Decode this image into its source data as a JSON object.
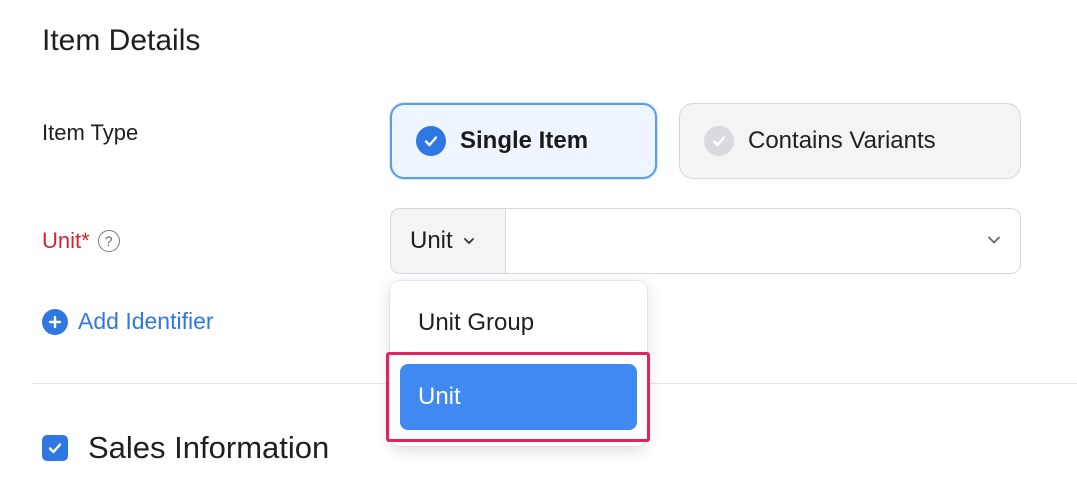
{
  "section": {
    "title": "Item Details"
  },
  "item_type": {
    "label": "Item Type",
    "options": [
      {
        "label": "Single Item",
        "selected": true
      },
      {
        "label": "Contains Variants",
        "selected": false
      }
    ]
  },
  "unit": {
    "label": "Unit*",
    "help_icon": "question-circle-icon",
    "toggle_label": "Unit",
    "value": "",
    "dropdown": {
      "options": [
        "Unit Group",
        "Unit"
      ],
      "highlighted": "Unit"
    }
  },
  "add_identifier": {
    "label": "Add Identifier"
  },
  "sales": {
    "label": "Sales Information",
    "checked": true
  },
  "colors": {
    "accent": "#2f78e4",
    "selected_option": "#4189f2",
    "required_label": "#d0262e",
    "highlight_border": "#e0245e"
  }
}
